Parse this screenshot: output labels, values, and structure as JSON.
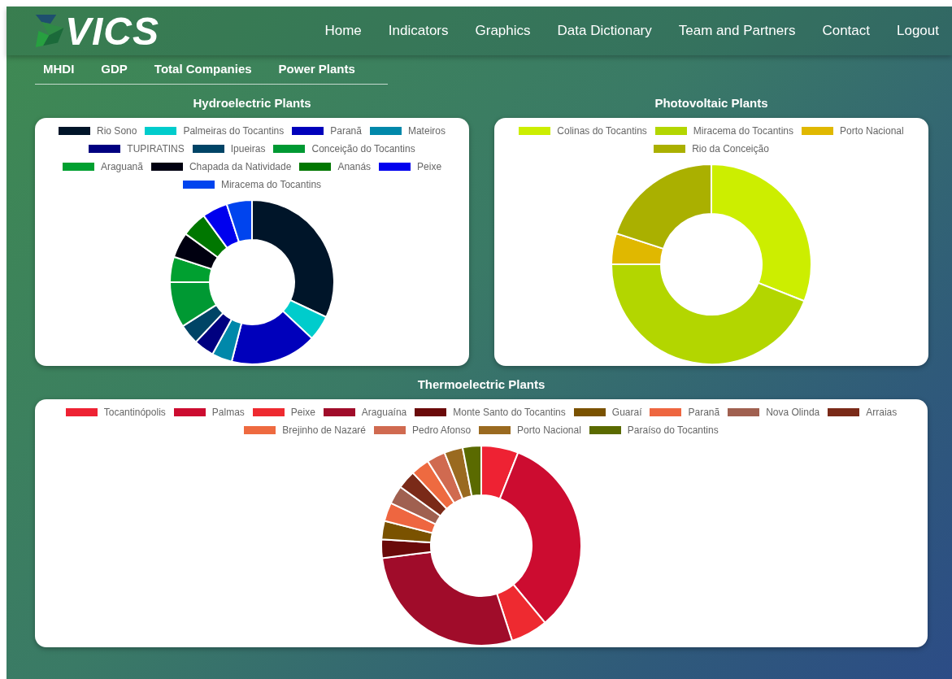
{
  "brand": {
    "name": "VICS"
  },
  "nav": [
    {
      "label": "Home"
    },
    {
      "label": "Indicators"
    },
    {
      "label": "Graphics"
    },
    {
      "label": "Data Dictionary"
    },
    {
      "label": "Team and Partners"
    },
    {
      "label": "Contact"
    },
    {
      "label": "Logout"
    }
  ],
  "subnav": [
    {
      "label": "MHDI"
    },
    {
      "label": "GDP"
    },
    {
      "label": "Total Companies"
    },
    {
      "label": "Power Plants"
    }
  ],
  "charts": [
    {
      "title": "Hydroelectric Plants",
      "legend": [
        {
          "label": "Rio Sono",
          "color": "#001529"
        },
        {
          "label": "Palmeiras do Tocantins",
          "color": "#00cccc"
        },
        {
          "label": "Paranã",
          "color": "#0000bb"
        },
        {
          "label": "Mateiros",
          "color": "#0088aa"
        },
        {
          "label": "TUPIRATINS",
          "color": "#000080"
        },
        {
          "label": "Ipueiras",
          "color": "#004466"
        },
        {
          "label": "Conceição do Tocantins",
          "color": "#009933"
        },
        {
          "label": "Araguanã",
          "color": "#00a030"
        },
        {
          "label": "Chapada da Natividade",
          "color": "#000010"
        },
        {
          "label": "Ananás",
          "color": "#007700"
        },
        {
          "label": "Peixe",
          "color": "#0000ee"
        },
        {
          "label": "Miracema do Tocantins",
          "color": "#0044ee"
        }
      ]
    },
    {
      "title": "Photovoltaic Plants",
      "legend": [
        {
          "label": "Colinas do Tocantins",
          "color": "#ccee00"
        },
        {
          "label": "Miracema do Tocantins",
          "color": "#b3d600"
        },
        {
          "label": "Porto Nacional",
          "color": "#e0b800"
        },
        {
          "label": "Rio da Conceição",
          "color": "#aab000"
        }
      ]
    },
    {
      "title": "Thermoelectric Plants",
      "legend": [
        {
          "label": "Tocantinópolis",
          "color": "#ee2233"
        },
        {
          "label": "Palmas",
          "color": "#cc0c30"
        },
        {
          "label": "Peixe",
          "color": "#ee2a30"
        },
        {
          "label": "Araguaína",
          "color": "#a00c2a"
        },
        {
          "label": "Monte Santo do Tocantins",
          "color": "#6a0a0a"
        },
        {
          "label": "Guaraí",
          "color": "#7a5200"
        },
        {
          "label": "Paranã",
          "color": "#ee6640"
        },
        {
          "label": "Nova Olinda",
          "color": "#a06050"
        },
        {
          "label": "Arraias",
          "color": "#7a2a18"
        },
        {
          "label": "Brejinho de Nazaré",
          "color": "#ee6a40"
        },
        {
          "label": "Pedro Afonso",
          "color": "#d06a50"
        },
        {
          "label": "Porto Nacional",
          "color": "#9a6a20"
        },
        {
          "label": "Paraíso do Tocantins",
          "color": "#5a6a00"
        }
      ]
    }
  ]
}
